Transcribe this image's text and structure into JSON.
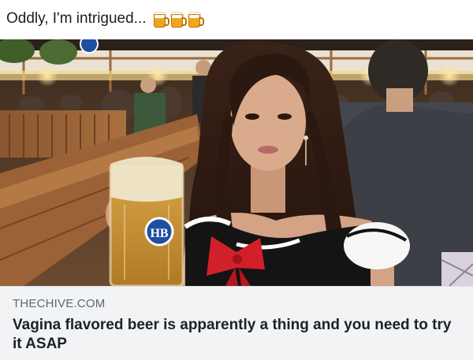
{
  "post": {
    "text": "Oddly, I'm intrigued...",
    "emoji_name": "beer-mug-icon",
    "emoji_count": 3
  },
  "photo": {
    "mug_logo": "HB"
  },
  "link_preview": {
    "domain": "THECHIVE.COM",
    "headline": "Vagina flavored beer is apparently a thing and you need to try it ASAP"
  },
  "colors": {
    "preview_background": "#f2f3f5",
    "domain_text": "#606770",
    "headline_text": "#1d2129"
  }
}
